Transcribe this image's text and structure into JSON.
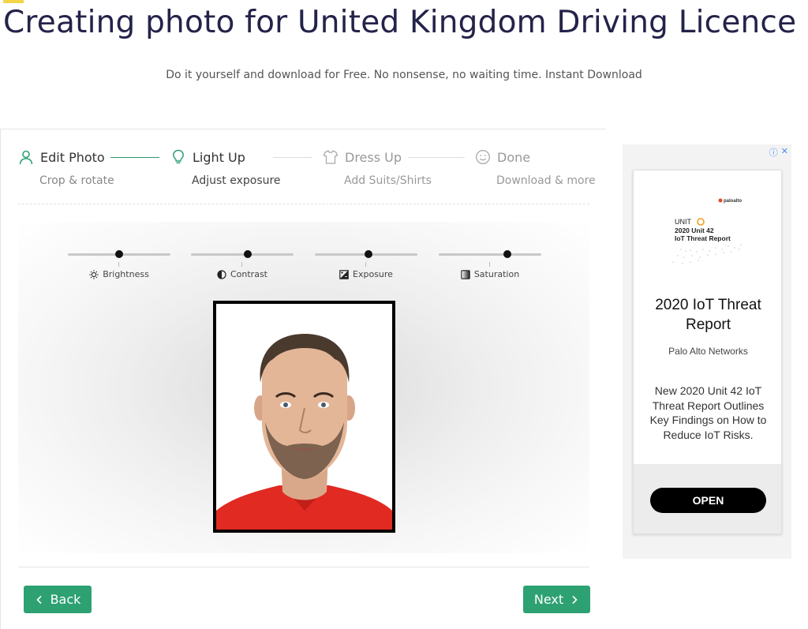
{
  "page": {
    "title": "Creating photo for United Kingdom Driving Licence",
    "subtitle": "Do it yourself and download for Free. No nonsense, no waiting time. Instant Download"
  },
  "steps": [
    {
      "title": "Edit Photo",
      "subtitle": "Crop & rotate",
      "icon": "user-icon",
      "state": "done"
    },
    {
      "title": "Light Up",
      "subtitle": "Adjust exposure",
      "icon": "lightbulb-icon",
      "state": "current"
    },
    {
      "title": "Dress Up",
      "subtitle": "Add Suits/Shirts",
      "icon": "shirt-icon",
      "state": "inactive"
    },
    {
      "title": "Done",
      "subtitle": "Download & more",
      "icon": "smiley-icon",
      "state": "inactive"
    }
  ],
  "sliders": [
    {
      "label": "Brightness",
      "icon": "sun-icon",
      "value": 0.5
    },
    {
      "label": "Contrast",
      "icon": "contrast-icon",
      "value": 0.55
    },
    {
      "label": "Exposure",
      "icon": "exposure-icon",
      "value": 0.52
    },
    {
      "label": "Saturation",
      "icon": "saturation-icon",
      "value": 0.67
    }
  ],
  "buttons": {
    "back": "Back",
    "next": "Next"
  },
  "ad": {
    "logo_brand": "paloalto",
    "logo_unit": "UNIT",
    "logo_line1": "2020 Unit 42",
    "logo_line2": "IoT Threat Report",
    "headline": "2020 IoT Threat Report",
    "brand": "Palo Alto Networks",
    "body": "New 2020 Unit 42 IoT Threat Report Outlines Key Findings on How to Reduce IoT Risks.",
    "cta": "OPEN",
    "info_icon": "ⓘ",
    "close_icon": "✕"
  },
  "colors": {
    "accent": "#2ea173",
    "title": "#23234a",
    "highlight": "#f5d547"
  }
}
